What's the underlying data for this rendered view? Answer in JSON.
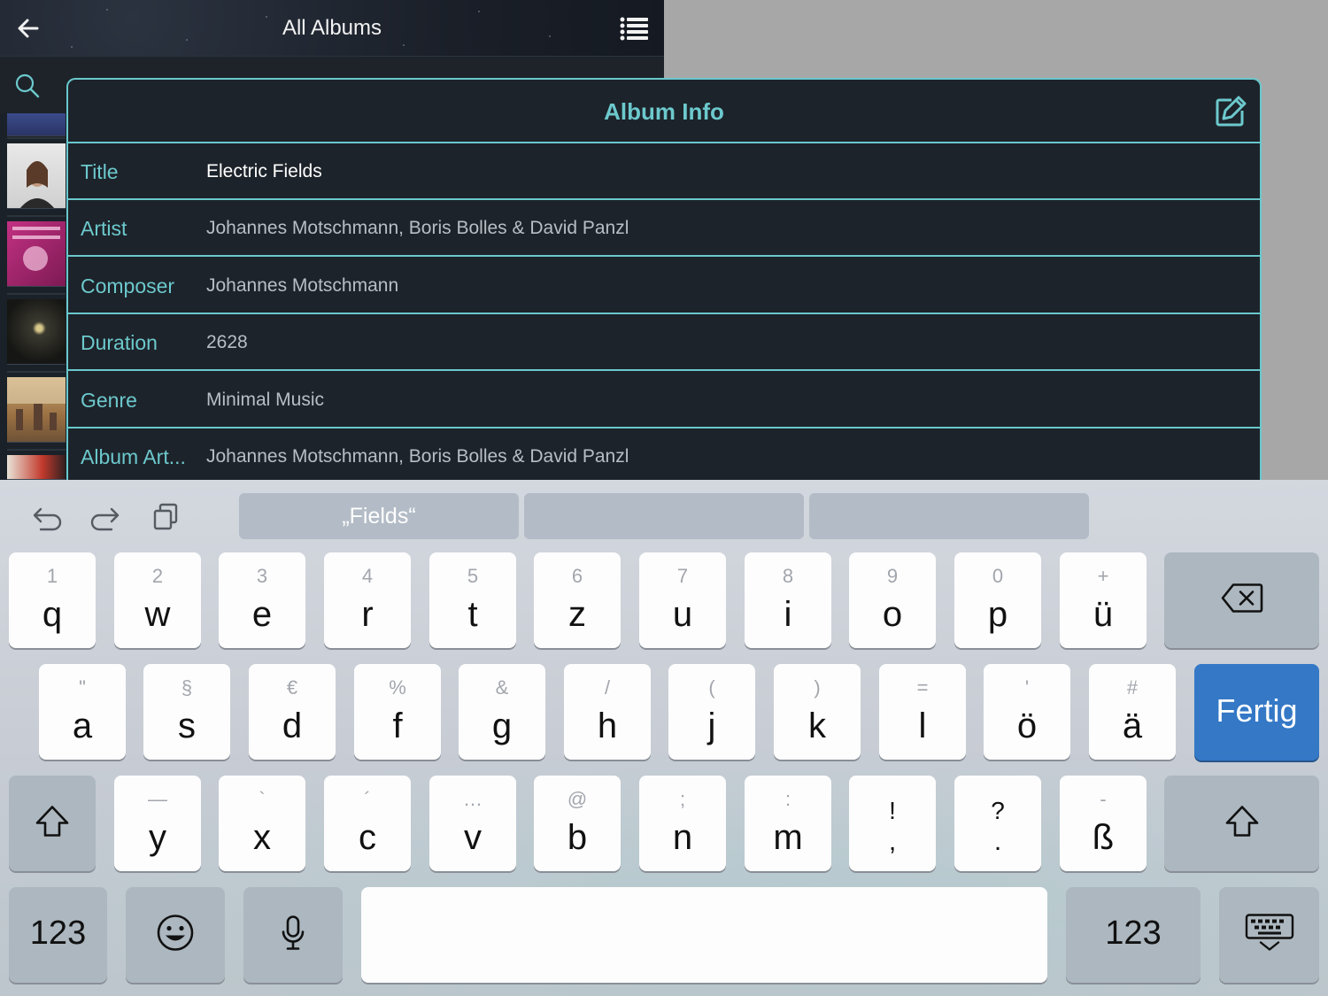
{
  "nav": {
    "title": "All Albums"
  },
  "sheet": {
    "title": "Album Info",
    "rows": [
      {
        "label": "Title",
        "value": "Electric Fields"
      },
      {
        "label": "Artist",
        "value": "Johannes Motschmann, Boris Bolles & David Panzl"
      },
      {
        "label": "Composer",
        "value": "Johannes Motschmann"
      },
      {
        "label": "Duration",
        "value": "2628"
      },
      {
        "label": "Genre",
        "value": "Minimal Music"
      },
      {
        "label": "Album Art...",
        "value": "Johannes Motschmann, Boris Bolles & David Panzl"
      }
    ]
  },
  "keyboard": {
    "suggestions": [
      "„Fields“",
      "",
      ""
    ],
    "row1": [
      {
        "sub": "1",
        "main": "q"
      },
      {
        "sub": "2",
        "main": "w"
      },
      {
        "sub": "3",
        "main": "e"
      },
      {
        "sub": "4",
        "main": "r"
      },
      {
        "sub": "5",
        "main": "t"
      },
      {
        "sub": "6",
        "main": "z"
      },
      {
        "sub": "7",
        "main": "u"
      },
      {
        "sub": "8",
        "main": "i"
      },
      {
        "sub": "9",
        "main": "o"
      },
      {
        "sub": "0",
        "main": "p"
      },
      {
        "sub": "+",
        "main": "ü"
      }
    ],
    "row2": [
      {
        "sub": "\"",
        "main": "a"
      },
      {
        "sub": "§",
        "main": "s"
      },
      {
        "sub": "€",
        "main": "d"
      },
      {
        "sub": "%",
        "main": "f"
      },
      {
        "sub": "&",
        "main": "g"
      },
      {
        "sub": "/",
        "main": "h"
      },
      {
        "sub": "(",
        "main": "j"
      },
      {
        "sub": ")",
        "main": "k"
      },
      {
        "sub": "=",
        "main": "l"
      },
      {
        "sub": "'",
        "main": "ö"
      },
      {
        "sub": "#",
        "main": "ä"
      }
    ],
    "row3": [
      {
        "sub": "—",
        "main": "y"
      },
      {
        "sub": "`",
        "main": "x"
      },
      {
        "sub": "´",
        "main": "c"
      },
      {
        "sub": "…",
        "main": "v"
      },
      {
        "sub": "@",
        "main": "b"
      },
      {
        "sub": ";",
        "main": "n"
      },
      {
        "sub": ":",
        "main": "m"
      },
      {
        "sub": "!",
        "main": ","
      },
      {
        "sub": "?",
        "main": "."
      },
      {
        "sub": "-",
        "main": "ß"
      }
    ],
    "return_label": "Fertig",
    "numbers_label": "123",
    "numbers_label_right": "123"
  },
  "colors": {
    "accent": "#69c8cc",
    "return_key": "#3478c6",
    "sheet_bg": "#1d232a"
  }
}
